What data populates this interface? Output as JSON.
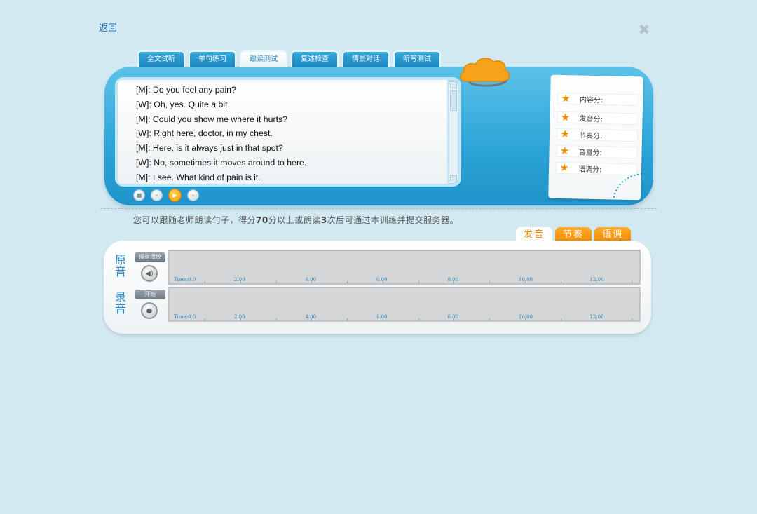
{
  "header": {
    "back_label": "返回",
    "close_symbol": "✖"
  },
  "tabs": [
    {
      "label": "全文试听",
      "active": false
    },
    {
      "label": "单句练习",
      "active": false
    },
    {
      "label": "跟读测试",
      "active": true
    },
    {
      "label": "复述检查",
      "active": false
    },
    {
      "label": "情景对话",
      "active": false
    },
    {
      "label": "听写测试",
      "active": false
    }
  ],
  "dialogue": [
    "[M]: Do you feel any pain?",
    "[W]: Oh, yes. Quite a bit.",
    "[M]: Could you show me where it hurts?",
    "[W]: Right here, doctor, in my chest.",
    "[M]: Here, is it always just in that spot?",
    "[W]: No, sometimes it moves around to here.",
    "[M]: I see. What kind of pain is it."
  ],
  "playback": {
    "stop_icon": "■",
    "prev_icon": "«",
    "play_icon": "▶",
    "next_icon": "»"
  },
  "scores": [
    {
      "label": "内容分:",
      "icon": "★"
    },
    {
      "label": "发音分:",
      "icon": "★"
    },
    {
      "label": "节奏分:",
      "icon": "★"
    },
    {
      "label": "音量分:",
      "icon": "★"
    },
    {
      "label": "语调分:",
      "icon": "★"
    }
  ],
  "instruction": {
    "part1": "您可以跟随老师朗读句子，得分",
    "score": "70",
    "part2": "分以上或朗读",
    "times": "3",
    "part3": "次后可通过本训练并提交服务器。"
  },
  "analysis_tabs": [
    {
      "label": "发音",
      "active": true
    },
    {
      "label": "节奏",
      "active": false
    },
    {
      "label": "语调",
      "active": false
    }
  ],
  "original": {
    "side_label": "原音",
    "button_label": "慢速播放",
    "speaker_icon": "◀)"
  },
  "recording": {
    "side_label": "录音",
    "button_label": "开始",
    "mic_icon": "●"
  },
  "ruler": {
    "first_label": "Time:0.0",
    "labels": [
      "2.00",
      "4.00",
      "6.00",
      "8.00",
      "10.00",
      "12.00"
    ]
  },
  "colors": {
    "accent_blue": "#2a8cc4",
    "accent_orange": "#f08c00",
    "page_bg": "#d3e9f1"
  }
}
